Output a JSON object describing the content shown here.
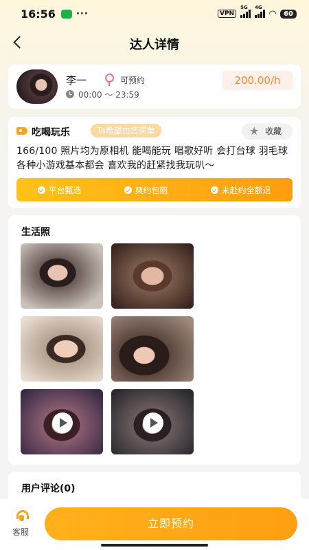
{
  "status_bar": {
    "time": "16:56",
    "dots": "···",
    "vpn": "VPN",
    "net1": "5G",
    "net2": "4G",
    "battery": "60"
  },
  "nav": {
    "title": "达人详情"
  },
  "profile": {
    "name": "李一",
    "status": "可预约",
    "time_range": "00:00 ～ 23:59",
    "price": "200.00/h"
  },
  "info": {
    "category": "吃喝玩乐",
    "hope_badge": "Ta希望由您买单",
    "favorite_label": "收藏",
    "description": "166/100 照片均为原相机 能喝能玩 唱歌好听 会打台球 羽毛球 各种小游戏基本都会 喜欢我的赶紧找我玩叭～",
    "guarantees": [
      "平台甄选",
      "爽约包赔",
      "未赴约全额退"
    ]
  },
  "photos": {
    "title": "生活照"
  },
  "reviews": {
    "title": "用户评论(0)"
  },
  "bottom": {
    "service_label": "客服",
    "book_label": "立即预约"
  },
  "colors": {
    "accent": "#ffa814",
    "price": "#f08a2a"
  }
}
